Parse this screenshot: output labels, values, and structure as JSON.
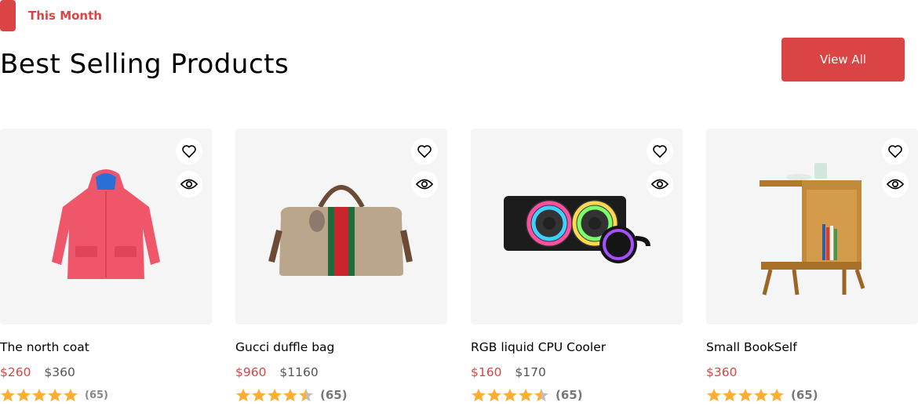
{
  "section": {
    "tag": "This Month",
    "title": "Best Selling Products",
    "view_all_label": "View All"
  },
  "colors": {
    "accent": "#DB4444",
    "star": "#FFAD33",
    "star_empty": "#BFBFBF",
    "card_bg": "#F5F5F5"
  },
  "products": [
    {
      "name": "The north coat",
      "price": "$260",
      "old_price": "$360",
      "rating": 5,
      "reviews": "(65)",
      "image": "red-jacket"
    },
    {
      "name": "Gucci duffle bag",
      "price": "$960",
      "old_price": "$1160",
      "rating": 4.5,
      "reviews": "(65)",
      "image": "duffle-bag"
    },
    {
      "name": "RGB liquid CPU Cooler",
      "price": "$160",
      "old_price": "$170",
      "rating": 4.5,
      "reviews": "(65)",
      "image": "cpu-cooler"
    },
    {
      "name": "Small BookSelf",
      "price": "$360",
      "old_price": "",
      "rating": 5,
      "reviews": "(65)",
      "image": "bookshelf"
    }
  ],
  "icons": {
    "wishlist": "heart-icon",
    "quick_view": "eye-icon",
    "star": "star-icon"
  }
}
